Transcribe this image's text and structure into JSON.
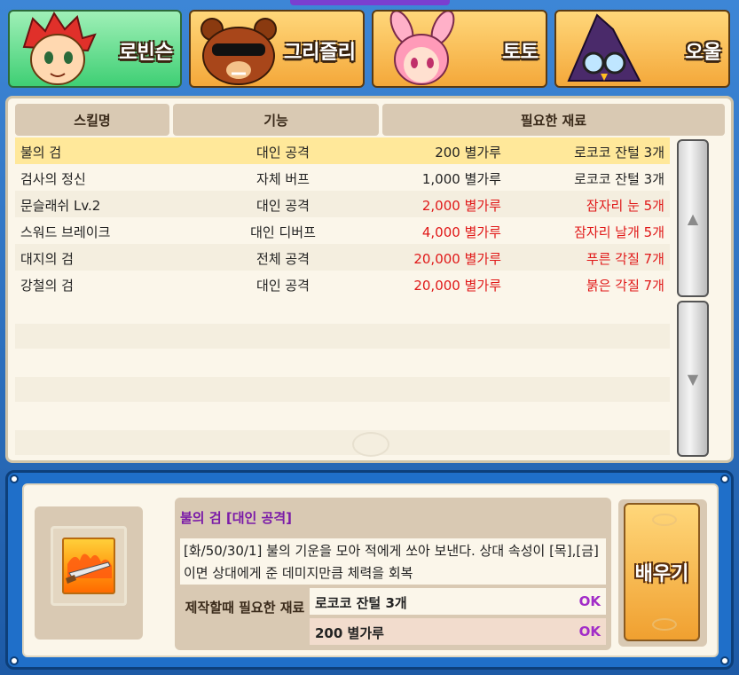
{
  "tabs": [
    {
      "label": "로빈슨",
      "icon": "robinson-portrait",
      "active": true
    },
    {
      "label": "그리즐리",
      "icon": "grizzly-bear-portrait",
      "active": false
    },
    {
      "label": "토토",
      "icon": "toto-rabbit-portrait",
      "active": false
    },
    {
      "label": "오울",
      "icon": "owl-wizard-portrait",
      "active": false
    }
  ],
  "table": {
    "headers": {
      "name": "스킬명",
      "function": "기능",
      "materials": "필요한 재료"
    },
    "rows": [
      {
        "name": "불의 검",
        "function": "대인 공격",
        "dust": "200 별가루",
        "item": "로코코 잔털 3개",
        "insufficient": false,
        "selected": true
      },
      {
        "name": "검사의 정신",
        "function": "자체 버프",
        "dust": "1,000 별가루",
        "item": "로코코 잔털 3개",
        "insufficient": false,
        "selected": false
      },
      {
        "name": "문슬래쉬 Lv.2",
        "function": "대인 공격",
        "dust": "2,000 별가루",
        "item": "잠자리 눈 5개",
        "insufficient": true,
        "selected": false
      },
      {
        "name": "스워드 브레이크",
        "function": "대인 디버프",
        "dust": "4,000 별가루",
        "item": "잠자리 날개 5개",
        "insufficient": true,
        "selected": false
      },
      {
        "name": "대지의 검",
        "function": "전체 공격",
        "dust": "20,000 별가루",
        "item": "푸른 각질 7개",
        "insufficient": true,
        "selected": false
      },
      {
        "name": "강철의 검",
        "function": "대인 공격",
        "dust": "20,000 별가루",
        "item": "붉은 각질 7개",
        "insufficient": true,
        "selected": false
      }
    ]
  },
  "detail": {
    "title": "불의 검 [대인 공격]",
    "description": "[화/50/30/1] 불의 기운을 모아 적에게 쏘아 보낸다. 상대 속성이 [목],[금]이면 상대에게 준 데미지만큼 체력을 회복",
    "icon": "fire-sword-icon",
    "requirement_label": "제작할때 필요한 재료",
    "requirements": [
      {
        "name": "로코코 잔털 3개",
        "status": "OK"
      },
      {
        "name": "200 별가루",
        "status": "OK"
      }
    ],
    "learn_button": "배우기"
  },
  "colors": {
    "frame": "#1f6fc9",
    "selected_row": "#ffe89a",
    "insufficient": "#e01818",
    "ok": "#a22cc8",
    "title": "#7a1aa8"
  }
}
